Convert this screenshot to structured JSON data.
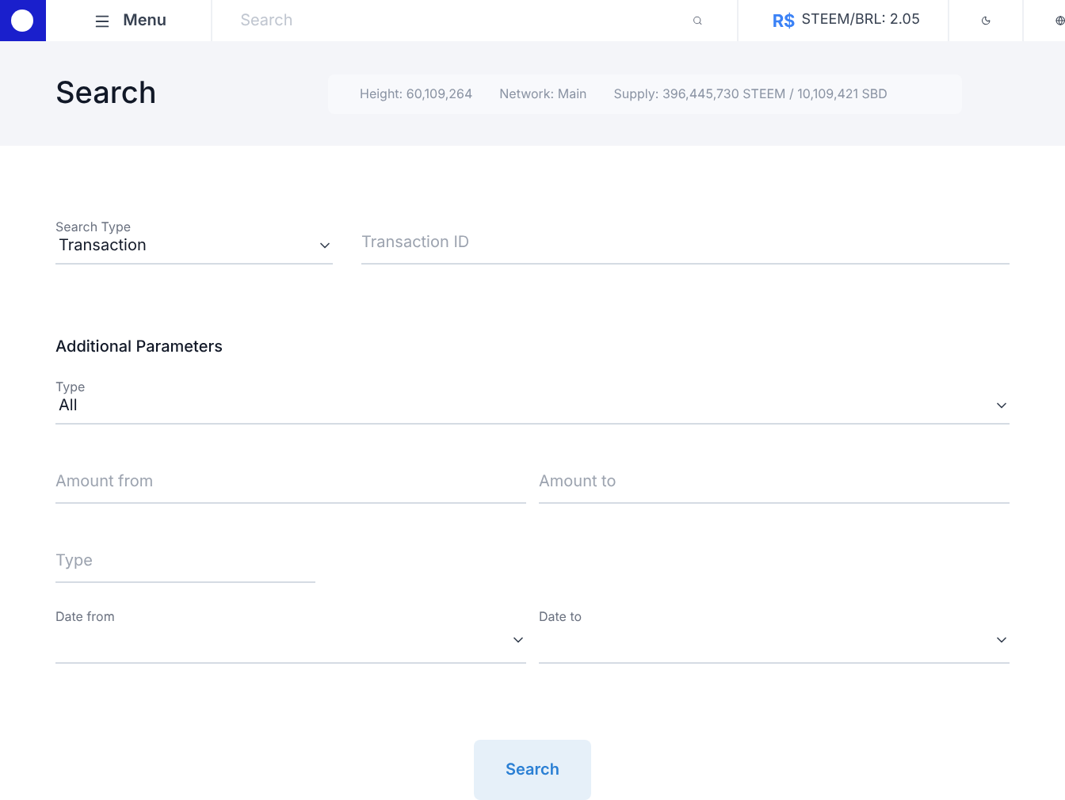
{
  "header": {
    "menu_label": "Menu",
    "search_placeholder": "Search",
    "price": {
      "symbol": "R$",
      "text": "STEEM/BRL: 2.05"
    }
  },
  "page_title": "Search",
  "stats": [
    "Height: 60,109,264",
    "Network: Main",
    "Supply: 396,445,730 STEEM / 10,109,421 SBD"
  ],
  "search_type": {
    "label": "Search Type",
    "value": "Transaction"
  },
  "transaction_id": {
    "placeholder": "Transaction ID"
  },
  "section_title": "Additional Parameters",
  "type_select": {
    "label": "Type",
    "value": "All"
  },
  "amount_from": {
    "placeholder": "Amount from"
  },
  "amount_to": {
    "placeholder": "Amount to"
  },
  "type_input": {
    "placeholder": "Type"
  },
  "date_from": {
    "label": "Date from"
  },
  "date_to": {
    "label": "Date to"
  },
  "submit": "Search"
}
